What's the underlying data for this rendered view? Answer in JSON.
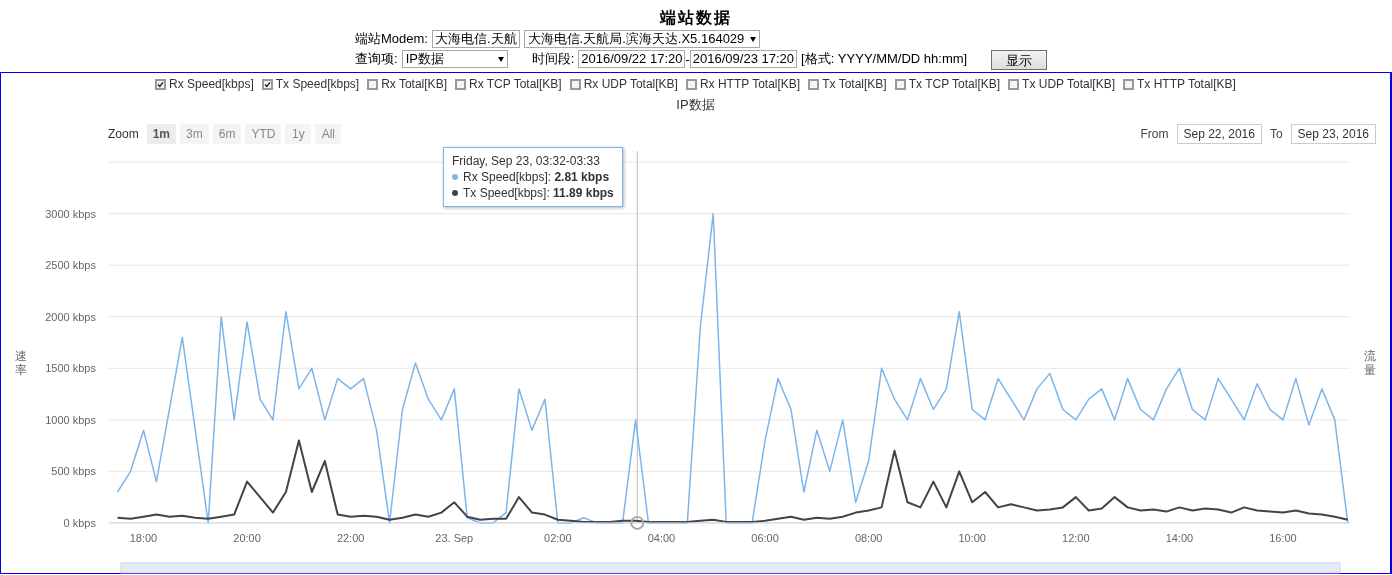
{
  "title": "端站数据",
  "form": {
    "modem_label": "端站Modem:",
    "modem_input": "大海电信.天航",
    "modem_select": "大海电信.天航局.滨海天达.X5.164029",
    "query_label": "查询项:",
    "query_select": "IP数据",
    "period_label": "时间段:",
    "period_from": "2016/09/22 17:20",
    "period_sep": "-",
    "period_to": "2016/09/23 17:20",
    "format_hint": "[格式: YYYY/MM/DD hh:mm]",
    "show_button": "显示"
  },
  "legend": [
    {
      "kind": "series",
      "checked": true
    },
    {
      "kind": "series",
      "checked": true
    },
    {
      "kind": "plain",
      "label": "Rx Total[KB]",
      "checked": false
    },
    {
      "kind": "plain",
      "label": "Rx TCP Total[KB]",
      "checked": false
    },
    {
      "kind": "plain",
      "label": "Rx UDP Total[KB]",
      "checked": false
    },
    {
      "kind": "plain",
      "label": "Rx HTTP Total[KB]",
      "checked": false
    },
    {
      "kind": "plain",
      "label": "Tx Total[KB]",
      "checked": false
    },
    {
      "kind": "plain",
      "label": "Tx TCP Total[KB]",
      "checked": false
    },
    {
      "kind": "plain",
      "label": "Tx UDP Total[KB]",
      "checked": false
    },
    {
      "kind": "plain",
      "label": "Tx HTTP Total[KB]",
      "checked": false
    }
  ],
  "chart_title": "IP数据",
  "zoom": {
    "label": "Zoom",
    "buttons": [
      {
        "label": "1m",
        "selected": true
      },
      {
        "label": "3m",
        "selected": false
      },
      {
        "label": "6m",
        "selected": false
      },
      {
        "label": "YTD",
        "selected": false
      },
      {
        "label": "1y",
        "selected": false
      },
      {
        "label": "All",
        "selected": false
      }
    ]
  },
  "range": {
    "from_label": "From",
    "from": "Sep 22, 2016",
    "to_label": "To",
    "to": "Sep 23, 2016"
  },
  "left_axis_title": "速率",
  "right_axis_title": "流量",
  "tooltip": {
    "title": "Friday, Sep 23, 03:32-03:33",
    "rows": [
      "Rx Speed[kbps]: **2.81 kbps**",
      "Tx Speed[kbps]: **11.89 kbps**"
    ]
  },
  "chart_data": {
    "type": "line",
    "grid": true,
    "ylim": [
      0,
      3500
    ],
    "xlim": [
      "2016-09-22T17:20",
      "2016-09-23T17:20"
    ],
    "x": [
      "2016-09-22T17:30",
      "2016-09-22T17:45",
      "2016-09-22T18:00",
      "2016-09-22T18:15",
      "2016-09-22T18:30",
      "2016-09-22T18:45",
      "2016-09-22T19:00",
      "2016-09-22T19:15",
      "2016-09-22T19:30",
      "2016-09-22T19:45",
      "2016-09-22T20:00",
      "2016-09-22T20:15",
      "2016-09-22T20:30",
      "2016-09-22T20:45",
      "2016-09-22T21:00",
      "2016-09-22T21:15",
      "2016-09-22T21:30",
      "2016-09-22T21:45",
      "2016-09-22T22:00",
      "2016-09-22T22:15",
      "2016-09-22T22:30",
      "2016-09-22T22:45",
      "2016-09-22T23:00",
      "2016-09-22T23:15",
      "2016-09-22T23:30",
      "2016-09-22T23:45",
      "2016-09-23T00:00",
      "2016-09-23T00:15",
      "2016-09-23T00:30",
      "2016-09-23T00:45",
      "2016-09-23T01:00",
      "2016-09-23T01:15",
      "2016-09-23T01:30",
      "2016-09-23T01:45",
      "2016-09-23T02:00",
      "2016-09-23T02:15",
      "2016-09-23T02:30",
      "2016-09-23T02:45",
      "2016-09-23T03:00",
      "2016-09-23T03:15",
      "2016-09-23T03:30",
      "2016-09-23T03:45",
      "2016-09-23T04:00",
      "2016-09-23T04:15",
      "2016-09-23T04:30",
      "2016-09-23T04:45",
      "2016-09-23T05:00",
      "2016-09-23T05:15",
      "2016-09-23T05:30",
      "2016-09-23T05:45",
      "2016-09-23T06:00",
      "2016-09-23T06:15",
      "2016-09-23T06:30",
      "2016-09-23T06:45",
      "2016-09-23T07:00",
      "2016-09-23T07:15",
      "2016-09-23T07:30",
      "2016-09-23T07:45",
      "2016-09-23T08:00",
      "2016-09-23T08:15",
      "2016-09-23T08:30",
      "2016-09-23T08:45",
      "2016-09-23T09:00",
      "2016-09-23T09:15",
      "2016-09-23T09:30",
      "2016-09-23T09:45",
      "2016-09-23T10:00",
      "2016-09-23T10:15",
      "2016-09-23T10:30",
      "2016-09-23T10:45",
      "2016-09-23T11:00",
      "2016-09-23T11:15",
      "2016-09-23T11:30",
      "2016-09-23T11:45",
      "2016-09-23T12:00",
      "2016-09-23T12:15",
      "2016-09-23T12:30",
      "2016-09-23T12:45",
      "2016-09-23T13:00",
      "2016-09-23T13:15",
      "2016-09-23T13:30",
      "2016-09-23T13:45",
      "2016-09-23T14:00",
      "2016-09-23T14:15",
      "2016-09-23T14:30",
      "2016-09-23T14:45",
      "2016-09-23T15:00",
      "2016-09-23T15:15",
      "2016-09-23T15:30",
      "2016-09-23T15:45",
      "2016-09-23T16:00",
      "2016-09-23T16:15",
      "2016-09-23T16:30",
      "2016-09-23T16:45",
      "2016-09-23T17:00",
      "2016-09-23T17:15"
    ],
    "series": [
      {
        "name": "Rx Speed[kbps]",
        "color": "#7cb5ec",
        "values": [
          300,
          500,
          900,
          400,
          1100,
          1800,
          900,
          0,
          2000,
          1000,
          1950,
          1200,
          1000,
          2050,
          1300,
          1500,
          1000,
          1400,
          1300,
          1400,
          900,
          0,
          1100,
          1550,
          1200,
          1000,
          1300,
          50,
          0,
          0,
          100,
          1300,
          900,
          1200,
          0,
          0,
          50,
          0,
          0,
          0,
          1000,
          0,
          0,
          0,
          0,
          1900,
          3000,
          0,
          0,
          0,
          800,
          1400,
          1100,
          300,
          900,
          500,
          1000,
          200,
          600,
          1500,
          1200,
          1000,
          1400,
          1100,
          1300,
          2050,
          1100,
          1000,
          1400,
          1200,
          1000,
          1300,
          1450,
          1100,
          1000,
          1200,
          1300,
          1000,
          1400,
          1100,
          1000,
          1300,
          1500,
          1100,
          1000,
          1400,
          1200,
          1000,
          1350,
          1100,
          1000,
          1400,
          950,
          1300,
          1000,
          0
        ]
      },
      {
        "name": "Tx Speed[kbps]",
        "color": "#434348",
        "values": [
          50,
          40,
          60,
          80,
          60,
          70,
          50,
          40,
          60,
          80,
          400,
          250,
          100,
          300,
          800,
          300,
          600,
          80,
          60,
          70,
          60,
          30,
          50,
          80,
          60,
          100,
          200,
          60,
          30,
          40,
          40,
          250,
          100,
          80,
          30,
          20,
          10,
          10,
          10,
          20,
          20,
          10,
          10,
          10,
          10,
          20,
          30,
          10,
          10,
          10,
          20,
          40,
          60,
          30,
          50,
          40,
          60,
          100,
          120,
          150,
          700,
          200,
          150,
          400,
          150,
          500,
          200,
          300,
          150,
          180,
          150,
          120,
          130,
          150,
          250,
          120,
          140,
          250,
          150,
          120,
          130,
          110,
          150,
          120,
          140,
          130,
          100,
          150,
          120,
          110,
          100,
          120,
          90,
          80,
          60,
          30
        ]
      }
    ],
    "xticks": [
      {
        "value": "2016-09-22T18:00",
        "label": "18:00"
      },
      {
        "value": "2016-09-22T20:00",
        "label": "20:00"
      },
      {
        "value": "2016-09-22T22:00",
        "label": "22:00"
      },
      {
        "value": "2016-09-23T00:00",
        "label": "23. Sep"
      },
      {
        "value": "2016-09-23T02:00",
        "label": "02:00"
      },
      {
        "value": "2016-09-23T04:00",
        "label": "04:00"
      },
      {
        "value": "2016-09-23T06:00",
        "label": "06:00"
      },
      {
        "value": "2016-09-23T08:00",
        "label": "08:00"
      },
      {
        "value": "2016-09-23T10:00",
        "label": "10:00"
      },
      {
        "value": "2016-09-23T12:00",
        "label": "12:00"
      },
      {
        "value": "2016-09-23T14:00",
        "label": "14:00"
      },
      {
        "value": "2016-09-23T16:00",
        "label": "16:00"
      }
    ],
    "yticks": [
      {
        "value": 0,
        "label": "0 kbps"
      },
      {
        "value": 500,
        "label": "500 kbps"
      },
      {
        "value": 1000,
        "label": "1000 kbps"
      },
      {
        "value": 1500,
        "label": "1500 kbps"
      },
      {
        "value": 2000,
        "label": "2000 kbps"
      },
      {
        "value": 2500,
        "label": "2500 kbps"
      },
      {
        "value": 3000,
        "label": "3000 kbps"
      }
    ],
    "ref_lines": [
      {
        "axis": "x",
        "value": "2016-09-23T03:32"
      }
    ]
  }
}
